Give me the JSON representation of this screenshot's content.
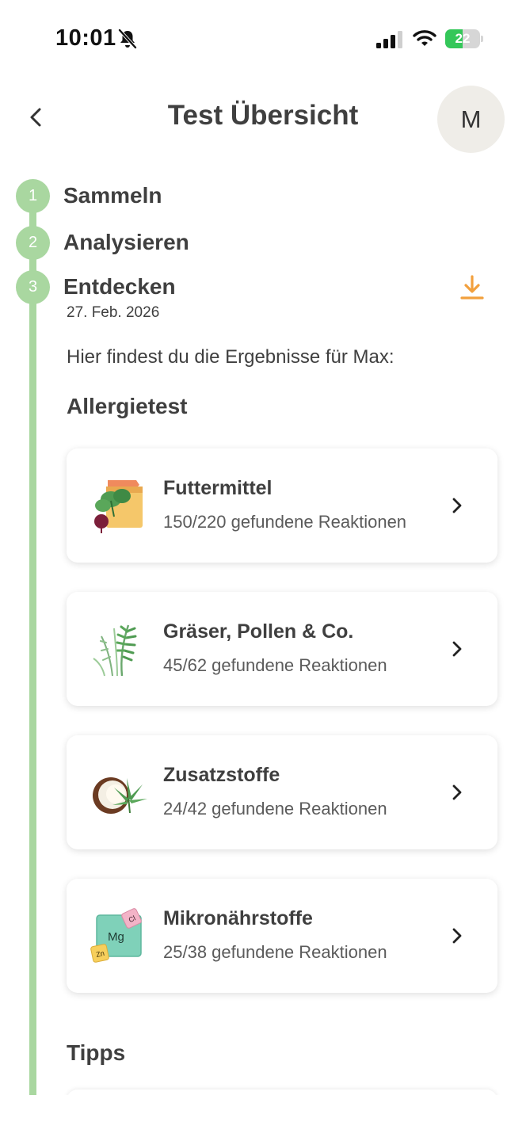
{
  "status_bar": {
    "time": "10:01",
    "battery_level": "22",
    "battery_percent": 22,
    "icons": [
      "bell-slash-icon",
      "cellular-signal-icon",
      "wifi-icon",
      "battery-charging-icon"
    ]
  },
  "header": {
    "title": "Test Übersicht",
    "avatar_initial": "M",
    "back_icon": "chevron-left-icon"
  },
  "steps": [
    {
      "number": "1",
      "label": "Sammeln"
    },
    {
      "number": "2",
      "label": "Analysieren"
    },
    {
      "number": "3",
      "label": "Entdecken",
      "date": "27. Feb. 2026"
    }
  ],
  "intro": "Hier findest du die Ergebnisse für Max:",
  "sections": {
    "allergy": "Allergietest",
    "tips": "Tipps"
  },
  "cards": [
    {
      "title": "Futtermittel",
      "subtitle": "150/220 gefundene Reaktionen",
      "icon": "feed-bag-icon"
    },
    {
      "title": "Gräser, Pollen & Co.",
      "subtitle": "45/62 gefundene Reaktionen",
      "icon": "grass-pollen-icon"
    },
    {
      "title": "Zusatzstoffe",
      "subtitle": "24/42 gefundene Reaktionen",
      "icon": "coconut-leaf-icon"
    },
    {
      "title": "Mikronährstoffe",
      "subtitle": "25/38 gefundene Reaktionen",
      "icon": "mineral-tiles-icon",
      "tiles": [
        "Mg",
        "Cl",
        "Zn"
      ]
    }
  ],
  "colors": {
    "accent_green": "#a9d7a0",
    "download_orange": "#f2a03d",
    "battery_green": "#34c759",
    "text": "#3f3f3f",
    "avatar_bg": "#efede8"
  }
}
